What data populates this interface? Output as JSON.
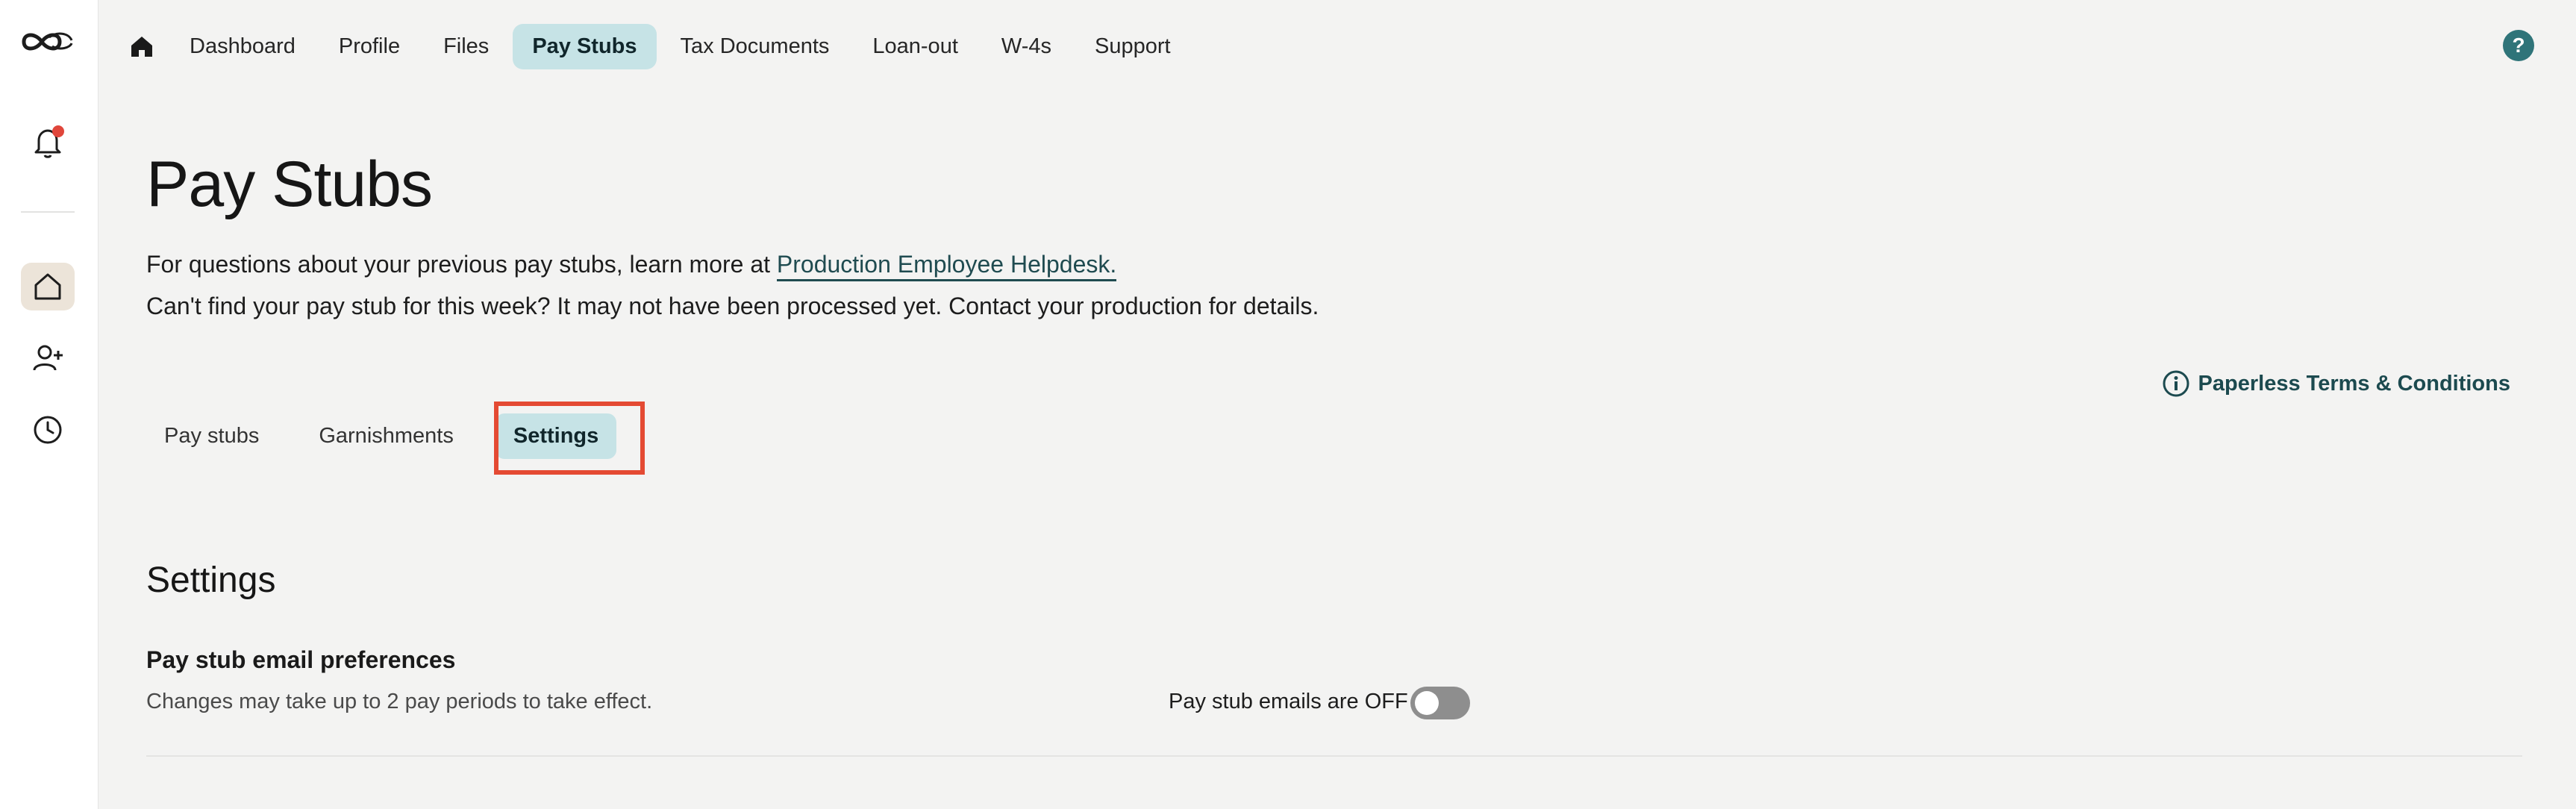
{
  "nav": {
    "items": [
      {
        "label": "Dashboard"
      },
      {
        "label": "Profile"
      },
      {
        "label": "Files"
      },
      {
        "label": "Pay Stubs",
        "active": true
      },
      {
        "label": "Tax Documents"
      },
      {
        "label": "Loan-out"
      },
      {
        "label": "W-4s"
      },
      {
        "label": "Support"
      }
    ],
    "help_label": "?"
  },
  "rail": {
    "notification_badge": true
  },
  "page": {
    "title": "Pay Stubs",
    "intro_line1_prefix": "For questions about your previous pay stubs, learn more at ",
    "intro_link": "Production Employee Helpdesk.",
    "intro_line2": "Can't find your pay stub for this week? It may not have been processed yet. Contact your production for details.",
    "terms_link": "Paperless Terms & Conditions"
  },
  "tabs": [
    {
      "label": "Pay stubs"
    },
    {
      "label": "Garnishments"
    },
    {
      "label": "Settings",
      "active": true
    }
  ],
  "settings": {
    "section_title": "Settings",
    "pref_title": "Pay stub email preferences",
    "pref_subtitle": "Changes may take up to 2 pay periods to take effect.",
    "toggle_label": "Pay stub emails are OFF",
    "toggle_on": false
  },
  "colors": {
    "accent": "#c6e3e6",
    "accent_dark": "#2f7479",
    "highlight": "#e44a33",
    "badge": "#e0463b"
  }
}
